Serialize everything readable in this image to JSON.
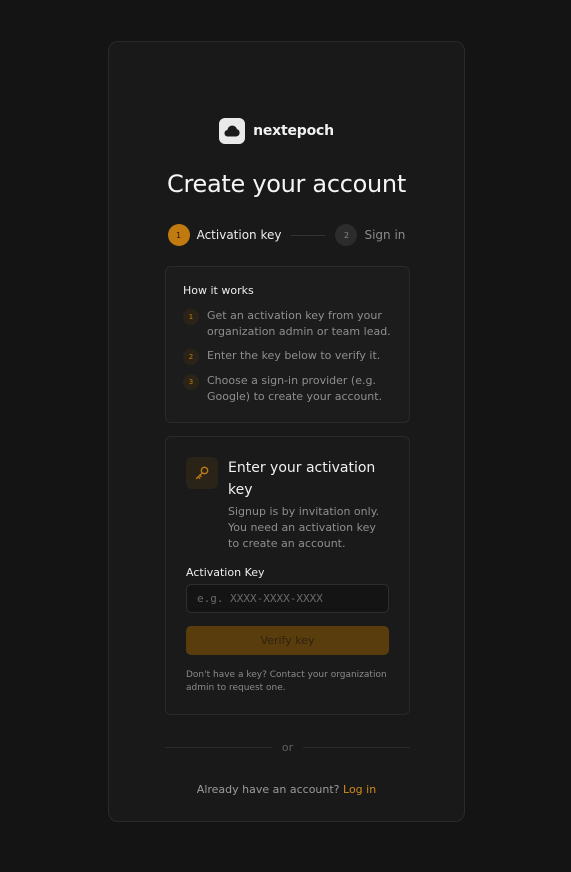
{
  "brand": {
    "name": "nextepoch",
    "icon": "cloud-icon"
  },
  "page": {
    "title": "Create your account"
  },
  "stepper": {
    "steps": [
      {
        "num": "1",
        "label": "Activation key",
        "state": "active"
      },
      {
        "num": "2",
        "label": "Sign in",
        "state": "inactive"
      }
    ]
  },
  "how": {
    "title": "How it works",
    "items": [
      {
        "num": "1",
        "text": "Get an activation key from your organization admin or team lead."
      },
      {
        "num": "2",
        "text": "Enter the key below to verify it."
      },
      {
        "num": "3",
        "text": "Choose a sign-in provider (e.g. Google) to create your account."
      }
    ]
  },
  "activation": {
    "icon": "key-icon",
    "title": "Enter your activation key",
    "description": "Signup is by invitation only. You need an activation key to create an account.",
    "field_label": "Activation Key",
    "placeholder": "e.g. XXXX-XXXX-XXXX",
    "value": "",
    "button_label": "Verify key",
    "help": "Don't have a key? Contact your organization admin to request one."
  },
  "divider": {
    "label": "or"
  },
  "footer": {
    "prompt": "Already have an account?",
    "link": "Log in"
  },
  "colors": {
    "accent": "#c07a10",
    "background": "#141414",
    "card": "#191919"
  }
}
